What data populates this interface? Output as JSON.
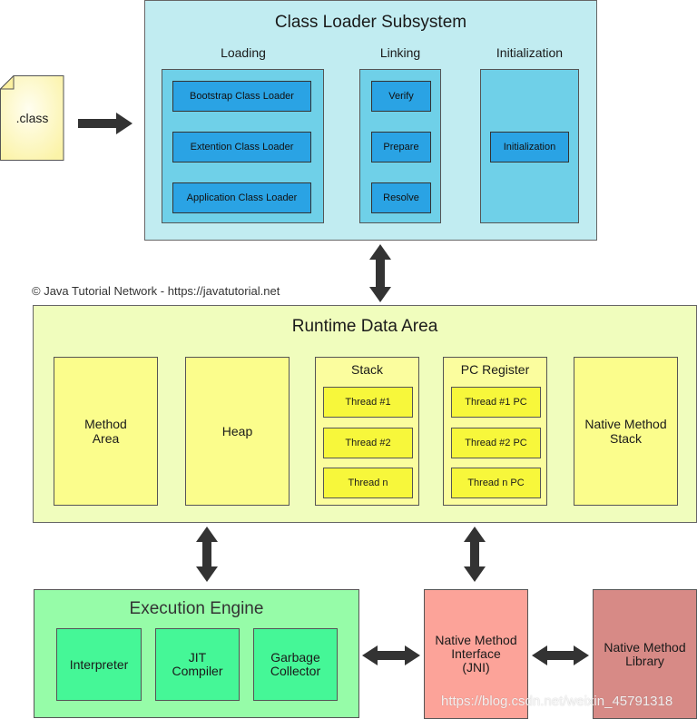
{
  "class_file": {
    "label": ".class"
  },
  "class_loader": {
    "title": "Class Loader Subsystem",
    "loading": {
      "title": "Loading",
      "items": [
        "Bootstrap Class Loader",
        "Extention Class Loader",
        "Application Class Loader"
      ]
    },
    "linking": {
      "title": "Linking",
      "items": [
        "Verify",
        "Prepare",
        "Resolve"
      ]
    },
    "initialization": {
      "title": "Initialization",
      "items": [
        "Initialization"
      ]
    }
  },
  "credit": "© Java Tutorial Network - https://javatutorial.net",
  "runtime_data_area": {
    "title": "Runtime Data Area",
    "method_area": "Method\nArea",
    "heap": "Heap",
    "stack": {
      "title": "Stack",
      "items": [
        "Thread #1",
        "Thread #2",
        "Thread n"
      ]
    },
    "pc_register": {
      "title": "PC Register",
      "items": [
        "Thread #1 PC",
        "Thread #2 PC",
        "Thread n PC"
      ]
    },
    "native_method_stack": "Native Method\nStack"
  },
  "execution_engine": {
    "title": "Execution Engine",
    "items": [
      "Interpreter",
      "JIT\nCompiler",
      "Garbage\nCollector"
    ]
  },
  "jni": {
    "label": "Native Method\nInterface\n(JNI)"
  },
  "native_library": {
    "label": "Native Method\nLibrary"
  },
  "watermark": "https://blog.csdn.net/weixin_45791318",
  "colors": {
    "class_loader_bg": "#c1ecf1",
    "class_loader_group": "#6fd0e8",
    "class_loader_box": "#2aa3e4",
    "runtime_bg": "#f0fdbd",
    "runtime_box": "#fbfd8c",
    "thread_box": "#f7f73b",
    "exec_bg": "#96fca8",
    "exec_box": "#45f797",
    "jni": "#fca399",
    "native_library": "#d78a86",
    "arrow": "#333333"
  }
}
